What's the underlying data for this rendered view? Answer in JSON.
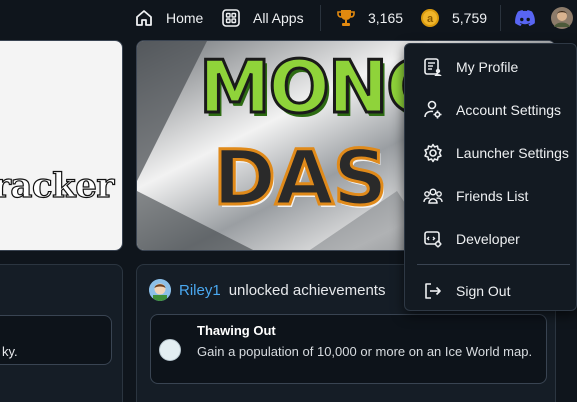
{
  "nav": {
    "home_label": "Home",
    "all_apps_label": "All Apps",
    "trophy_count": "3,165",
    "coin_count": "5,759"
  },
  "cards": {
    "left_title": "racker",
    "game_logo_line1": "MONG",
    "game_logo_line2": "DAS",
    "left_bottom_text": "ky."
  },
  "feed": {
    "username": "Riley1",
    "action": "unlocked achievements",
    "achievement": {
      "title": "Thawing Out",
      "description": "Gain a population of 10,000 or more on an Ice World map."
    }
  },
  "menu": {
    "items": [
      {
        "label": "My Profile",
        "icon": "profile-card-icon"
      },
      {
        "label": "Account Settings",
        "icon": "user-gear-icon"
      },
      {
        "label": "Launcher Settings",
        "icon": "gear-icon"
      },
      {
        "label": "Friends List",
        "icon": "friends-icon"
      },
      {
        "label": "Developer",
        "icon": "developer-icon"
      },
      {
        "label": "Sign Out",
        "icon": "sign-out-icon"
      }
    ]
  },
  "colors": {
    "background": "#0f151c",
    "username": "#4aa8f0",
    "trophy": "#e2890f",
    "coin": "#d99a0e",
    "discord": "#5865f2"
  }
}
